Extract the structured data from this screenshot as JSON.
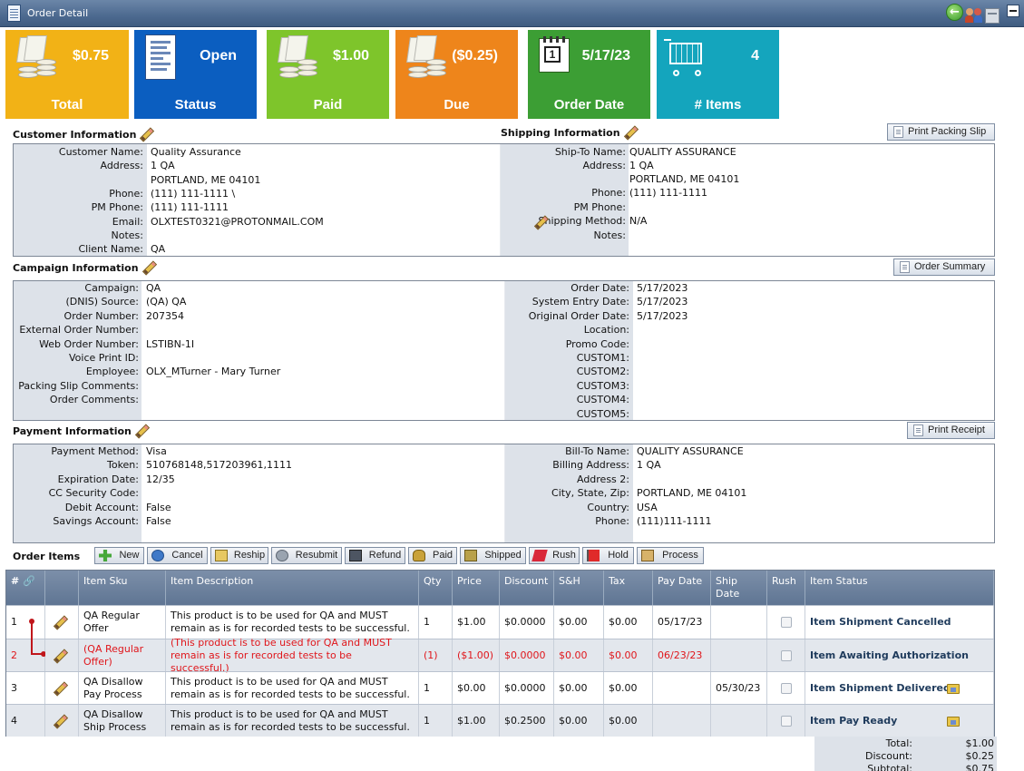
{
  "window": {
    "title": "Order Detail"
  },
  "tiles": [
    {
      "value": "$0.75",
      "label": "Total",
      "color": "#f2b216"
    },
    {
      "value": "Open",
      "label": "Status",
      "color": "#0b5ec0"
    },
    {
      "value": "$1.00",
      "label": "Paid",
      "color": "#7ec52b"
    },
    {
      "value": "($0.25)",
      "label": "Due",
      "color": "#ee851b"
    },
    {
      "value": "5/17/23",
      "label": "Order Date",
      "color": "#3c9e34"
    },
    {
      "value": "4",
      "label": "# Items",
      "color": "#14a5bd"
    }
  ],
  "customer": {
    "title": "Customer Information",
    "rows": [
      {
        "k": "Customer Name:",
        "v": "Quality Assurance"
      },
      {
        "k": "Address:",
        "v": "1 QA"
      },
      {
        "k": "",
        "v": "PORTLAND, ME 04101"
      },
      {
        "k": "Phone:",
        "v": "(111) 111-1111 \\"
      },
      {
        "k": "PM Phone:",
        "v": "(111) 111-1111"
      },
      {
        "k": "Email:",
        "v": "OLXTEST0321@PROTONMAIL.COM"
      },
      {
        "k": "Notes:",
        "v": ""
      },
      {
        "k": "Client Name:",
        "v": "QA"
      }
    ]
  },
  "shipping": {
    "title": "Shipping Information",
    "print_label": "Print Packing Slip",
    "rows": [
      {
        "k": "Ship-To Name:",
        "v": "QUALITY ASSURANCE"
      },
      {
        "k": "Address:",
        "v": "1 QA"
      },
      {
        "k": "",
        "v": "PORTLAND, ME 04101"
      },
      {
        "k": "Phone:",
        "v": "(111) 111-1111"
      },
      {
        "k": "PM Phone:",
        "v": ""
      },
      {
        "k": "Shipping Method:",
        "v": "N/A"
      },
      {
        "k": "Notes:",
        "v": ""
      }
    ]
  },
  "campaign": {
    "title": "Campaign Information",
    "summary_label": "Order Summary",
    "left": [
      {
        "k": "Campaign:",
        "v": "QA"
      },
      {
        "k": "(DNIS) Source:",
        "v": "(QA) QA"
      },
      {
        "k": "Order Number:",
        "v": "207354"
      },
      {
        "k": "External Order Number:",
        "v": ""
      },
      {
        "k": "Web Order Number:",
        "v": "LSTIBN-1I"
      },
      {
        "k": "Voice Print ID:",
        "v": ""
      },
      {
        "k": "Employee:",
        "v": "OLX_MTurner - Mary Turner"
      },
      {
        "k": "Packing Slip Comments:",
        "v": ""
      },
      {
        "k": "Order Comments:",
        "v": ""
      }
    ],
    "right": [
      {
        "k": "Order Date:",
        "v": "5/17/2023"
      },
      {
        "k": "System Entry Date:",
        "v": "5/17/2023"
      },
      {
        "k": "Original Order Date:",
        "v": "5/17/2023"
      },
      {
        "k": "Location:",
        "v": ""
      },
      {
        "k": "Promo Code:",
        "v": ""
      },
      {
        "k": "CUSTOM1:",
        "v": ""
      },
      {
        "k": "CUSTOM2:",
        "v": ""
      },
      {
        "k": "CUSTOM3:",
        "v": ""
      },
      {
        "k": "CUSTOM4:",
        "v": ""
      },
      {
        "k": "CUSTOM5:",
        "v": ""
      }
    ]
  },
  "payment": {
    "title": "Payment Information",
    "print_label": "Print Receipt",
    "left": [
      {
        "k": "Payment Method:",
        "v": "Visa"
      },
      {
        "k": "Token:",
        "v": "510768148,517203961,1111"
      },
      {
        "k": "Expiration Date:",
        "v": "12/35"
      },
      {
        "k": "CC Security Code:",
        "v": ""
      },
      {
        "k": "Debit Account:",
        "v": "False"
      },
      {
        "k": "Savings Account:",
        "v": "False"
      }
    ],
    "right": [
      {
        "k": "Bill-To Name:",
        "v": "QUALITY ASSURANCE"
      },
      {
        "k": "Billing Address:",
        "v": "1 QA"
      },
      {
        "k": "Address 2:",
        "v": ""
      },
      {
        "k": "City, State, Zip:",
        "v": "PORTLAND, ME 04101"
      },
      {
        "k": "Country:",
        "v": "USA"
      },
      {
        "k": "Phone:",
        "v": "(111)111-1111"
      }
    ]
  },
  "order_items": {
    "title": "Order Items",
    "toolbar": [
      {
        "label": "New",
        "icon": "plus-icon"
      },
      {
        "label": "Cancel",
        "icon": "cancel-icon"
      },
      {
        "label": "Reship",
        "icon": "reship-icon"
      },
      {
        "label": "Resubmit",
        "icon": "resubmit-icon"
      },
      {
        "label": "Refund",
        "icon": "refund-icon"
      },
      {
        "label": "Paid",
        "icon": "money-bag-icon"
      },
      {
        "label": "Shipped",
        "icon": "shipped-icon"
      },
      {
        "label": "Rush",
        "icon": "rush-icon"
      },
      {
        "label": "Hold",
        "icon": "flag-icon"
      },
      {
        "label": "Process",
        "icon": "process-icon"
      }
    ],
    "columns": [
      "# 🔗",
      "",
      "Item Sku",
      "Item Description",
      "Qty",
      "Price",
      "Discount",
      "S&H",
      "Tax",
      "Pay Date",
      "Ship Date",
      "Rush",
      "Item Status"
    ],
    "rows": [
      {
        "num": "1",
        "sku": "QA Regular Offer",
        "desc": "This product is to be used for QA and MUST remain as is for recorded tests to be successful.",
        "qty": "1",
        "price": "$1.00",
        "discount": "$0.0000",
        "sh": "$0.00",
        "tax": "$0.00",
        "pay_date": "05/17/23",
        "ship_date": "",
        "status": "Item Shipment Cancelled",
        "folder": false
      },
      {
        "num": "2",
        "sku": "(QA Regular Offer)",
        "desc": "(This product is to be used for QA and MUST remain as is for recorded tests to be successful.)",
        "qty": "(1)",
        "price": "($1.00)",
        "discount": "$0.0000",
        "sh": "$0.00",
        "tax": "$0.00",
        "pay_date": "06/23/23",
        "ship_date": "",
        "status": "Item Awaiting Authorization",
        "folder": false
      },
      {
        "num": "3",
        "sku": "QA Disallow Pay Process",
        "desc": "This product is to be used for QA and MUST remain as is for recorded tests to be successful.",
        "qty": "1",
        "price": "$0.00",
        "discount": "$0.0000",
        "sh": "$0.00",
        "tax": "$0.00",
        "pay_date": "",
        "ship_date": "05/30/23",
        "status": "Item Shipment Delivered",
        "folder": true
      },
      {
        "num": "4",
        "sku": "QA Disallow Ship Process",
        "desc": "This product is to be used for QA and MUST remain as is for recorded tests to be successful.",
        "qty": "1",
        "price": "$1.00",
        "discount": "$0.2500",
        "sh": "$0.00",
        "tax": "$0.00",
        "pay_date": "",
        "ship_date": "",
        "status": "Item Pay Ready",
        "folder": true
      }
    ]
  },
  "totals": [
    {
      "k": "Total:",
      "v": "$1.00"
    },
    {
      "k": "Discount:",
      "v": "$0.25"
    },
    {
      "k": "Subtotal:",
      "v": "$0.75"
    }
  ]
}
